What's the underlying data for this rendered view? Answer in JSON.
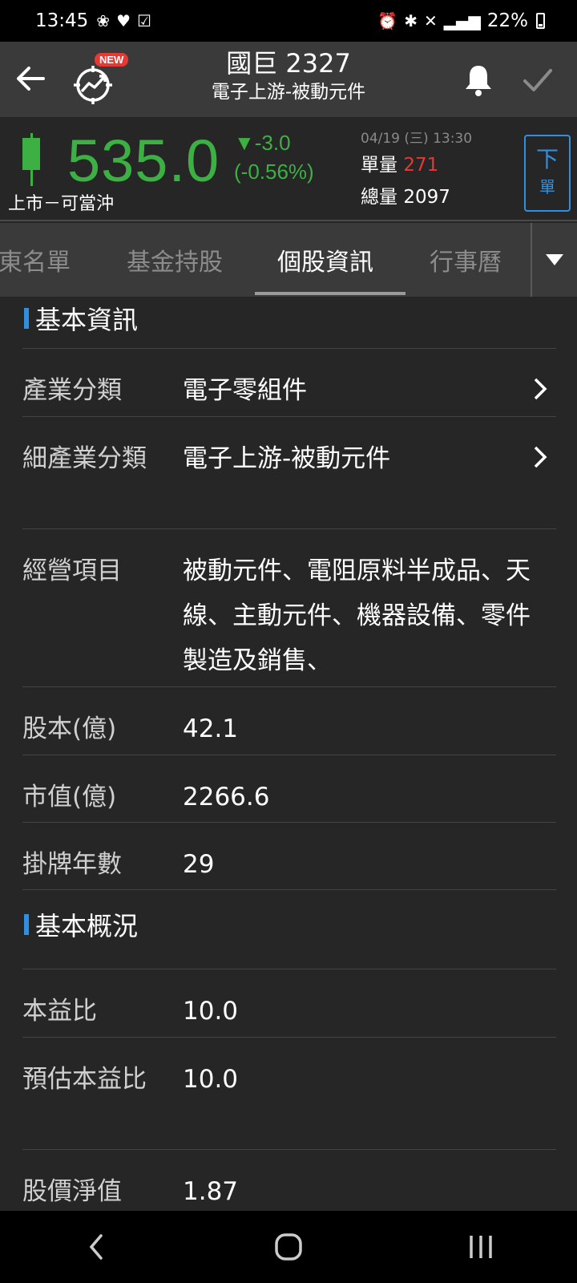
{
  "status_bar": {
    "time": "13:45",
    "battery": "22%"
  },
  "header": {
    "title": "國巨 2327",
    "subtitle": "電子上游-被動元件",
    "new_badge": "NEW"
  },
  "quote": {
    "price": "535.0",
    "change": "▼-3.0",
    "change_pct": "(-0.56%)",
    "market_tag": "上市－可當沖",
    "datetime": "04/19 (三) 13:30",
    "single_vol_label": "單量",
    "single_vol": "271",
    "total_vol_label": "總量",
    "total_vol": "2097",
    "order_button_top": "下",
    "order_button_bottom": "單",
    "colors": {
      "down": "#3cb043",
      "up": "#e53935",
      "accent": "#2f8fe0"
    }
  },
  "tabs": [
    {
      "label": "股東名單"
    },
    {
      "label": "基金持股"
    },
    {
      "label": "個股資訊",
      "active": true
    },
    {
      "label": "行事曆"
    }
  ],
  "sections": {
    "basic_info": {
      "title": "基本資訊",
      "rows": [
        {
          "label": "產業分類",
          "value": "電子零組件",
          "has_chevron": true
        },
        {
          "label": "細產業分類",
          "value": "電子上游-被動元件",
          "has_chevron": true
        },
        {
          "label": "經營項目",
          "value": "被動元件、電阻原料半成品、天線、主動元件、機器設備、零件製造及銷售、"
        },
        {
          "label": "股本(億)",
          "value": "42.1"
        },
        {
          "label": "市值(億)",
          "value": "2266.6"
        },
        {
          "label": "掛牌年數",
          "value": "29"
        }
      ]
    },
    "overview": {
      "title": "基本概況",
      "rows": [
        {
          "label": "本益比",
          "value": "10.0"
        },
        {
          "label": "預估本益比",
          "value": "10.0"
        },
        {
          "label": "股價淨值",
          "value": "1.87"
        }
      ]
    }
  }
}
